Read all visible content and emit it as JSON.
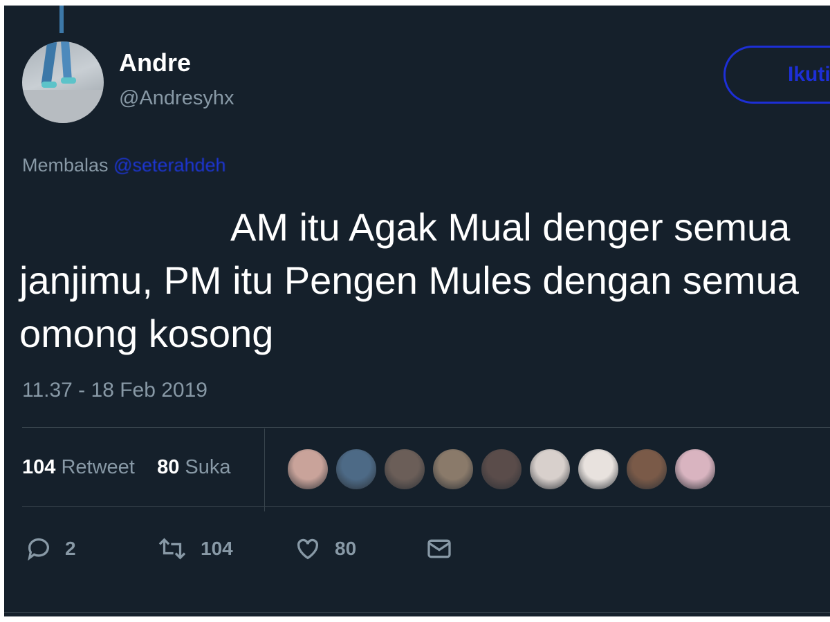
{
  "tweet": {
    "display_name": "Andre",
    "handle": "@Andresyhx",
    "follow_label": "Ikuti",
    "reply_prefix": "Membalas",
    "reply_mention": "@seterahdeh",
    "text_lines": [
      "AM itu Agak Mual denger semua",
      "janjimu, PM itu Pengen Mules dengan semua",
      "omong kosong"
    ],
    "timestamp": "11.37 - 18 Feb 2019"
  },
  "stats": {
    "retweet_count": "104",
    "retweet_label": "Retweet",
    "like_count": "80",
    "like_label": "Suka"
  },
  "likers": [
    {
      "name": "liker-1",
      "color": "#c9a39a"
    },
    {
      "name": "liker-2",
      "color": "#4d6a86"
    },
    {
      "name": "liker-3",
      "color": "#6b5e58"
    },
    {
      "name": "liker-4",
      "color": "#8a7a6a"
    },
    {
      "name": "liker-5",
      "color": "#5a4c4a"
    },
    {
      "name": "liker-6",
      "color": "#d8d0cc"
    },
    {
      "name": "liker-7",
      "color": "#e8e2de"
    },
    {
      "name": "liker-8",
      "color": "#7a5a48"
    },
    {
      "name": "liker-9",
      "color": "#d9b4c0"
    }
  ],
  "actions": {
    "reply_count": "2",
    "retweet_count": "104",
    "like_count": "80"
  },
  "icons": {
    "reply": "reply-icon",
    "retweet": "retweet-icon",
    "like": "heart-icon",
    "dm": "envelope-icon"
  },
  "colors": {
    "background": "#15202b",
    "text_primary": "#ffffff",
    "text_secondary": "#8899a6",
    "accent": "#1d2fd6",
    "divider": "#38444d"
  }
}
